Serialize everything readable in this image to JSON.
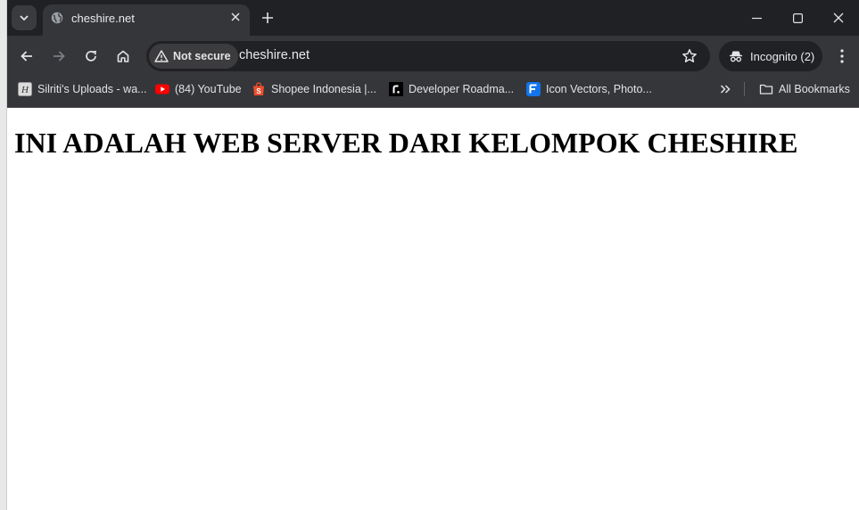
{
  "tab": {
    "title": "cheshire.net"
  },
  "omnibox": {
    "security_label": "Not secure",
    "url": "cheshire.net"
  },
  "profile": {
    "incognito_label": "Incognito (2)"
  },
  "bookmarks": {
    "items": [
      {
        "label": "Silriti's Uploads - wa...",
        "icon": "silriti-favicon"
      },
      {
        "label": "(84) YouTube",
        "icon": "youtube-icon"
      },
      {
        "label": "Shopee Indonesia |...",
        "icon": "shopee-icon"
      },
      {
        "label": "Developer Roadma...",
        "icon": "roadmap-icon"
      },
      {
        "label": "Icon Vectors, Photo...",
        "icon": "freepik-icon"
      }
    ],
    "overflow_icon": "chevron-double-right-icon",
    "all_bookmarks_label": "All Bookmarks"
  },
  "page": {
    "heading": "INI ADALAH WEB SERVER DARI KELOMPOK CHESHIRE"
  },
  "colors": {
    "chrome_dark": "#202124",
    "toolbar": "#35363a",
    "youtube_red": "#ff0000",
    "shopee_orange": "#ee4d2d",
    "freepik_blue": "#1273eb"
  }
}
